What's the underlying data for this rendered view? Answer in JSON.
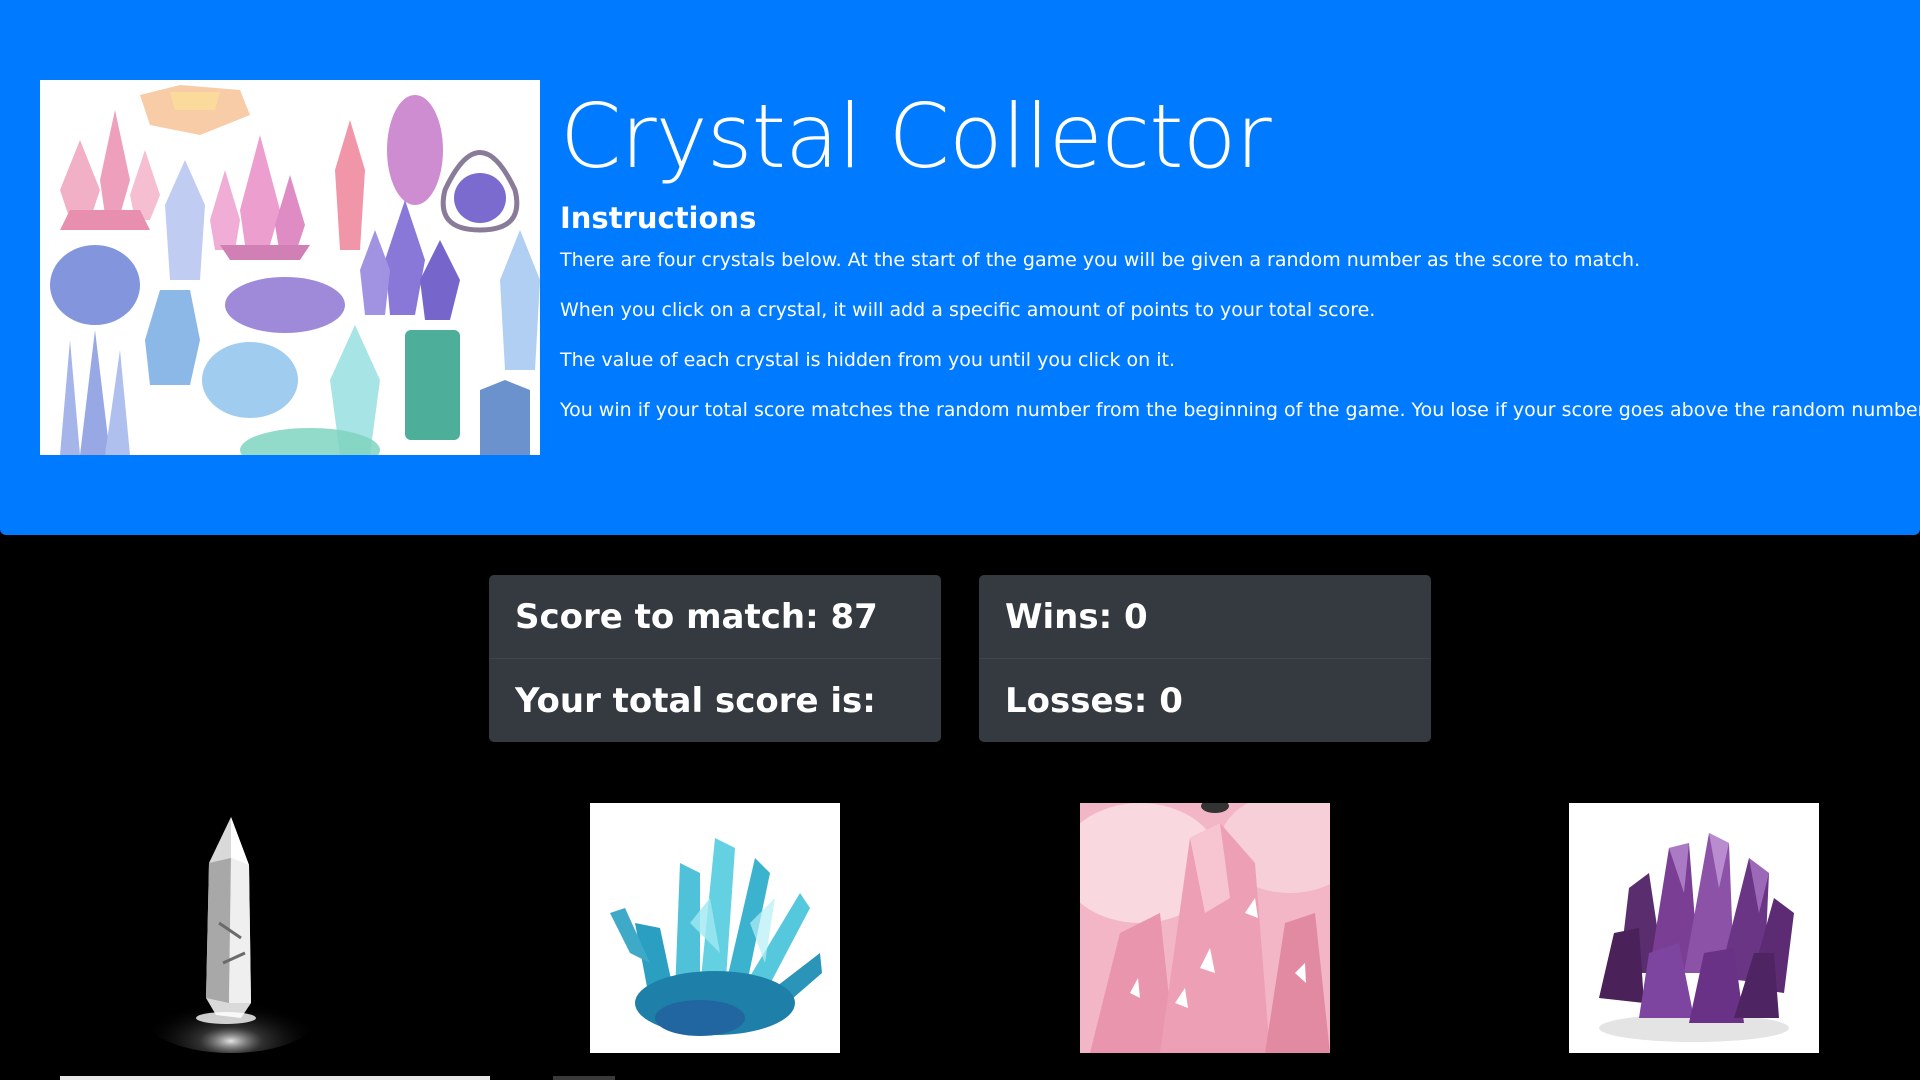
{
  "header": {
    "title": "Crystal Collector",
    "instructions_heading": "Instructions",
    "instructions": [
      "There are four crystals below. At the start of the game you will be given a random number as the score to match.",
      "When you click on a crystal, it will add a specific amount of points to your total score.",
      "The value of each crystal is hidden from you until you click on it.",
      "You win if your total score matches the random number from the beginning of the game. You lose if your score goes above the random number."
    ],
    "image_icon": "watercolor-crystals-illustration"
  },
  "scoreboard": {
    "score_to_match_label": "Score to match: 87",
    "total_score_label": "Your total score is:"
  },
  "record": {
    "wins_label": "Wins: 0",
    "losses_label": "Losses: 0"
  },
  "crystals": [
    {
      "icon": "clear-quartz-crystal-icon"
    },
    {
      "icon": "blue-crystal-cluster-icon"
    },
    {
      "icon": "pink-crystal-icon"
    },
    {
      "icon": "purple-crystal-cluster-icon"
    }
  ],
  "colors": {
    "jumbotron": "#007bff",
    "card": "#343a40",
    "background": "#000000",
    "text": "#ffffff"
  }
}
